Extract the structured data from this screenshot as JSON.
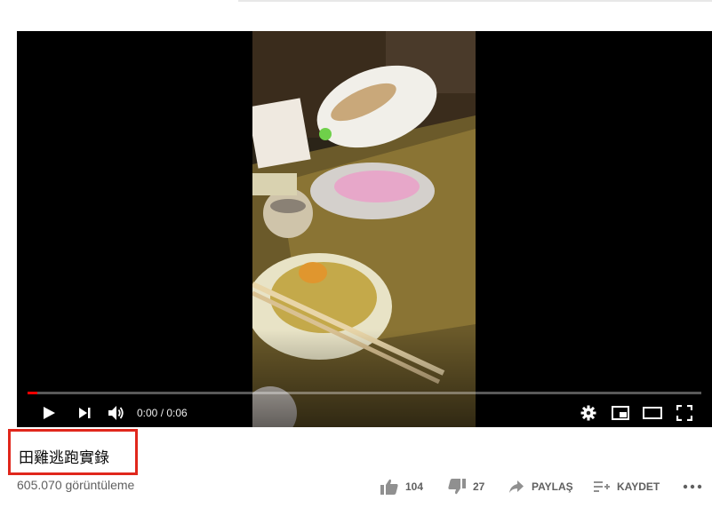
{
  "video": {
    "time_display": "0:00 / 0:06",
    "progress_fraction": 0.015
  },
  "title": "田雞逃跑實錄",
  "views": "605.070 görüntüleme",
  "actions": {
    "like_count": "104",
    "dislike_count": "27",
    "share_label": "PAYLAŞ",
    "save_label": "KAYDET"
  },
  "icons": {
    "play": "play-icon",
    "next": "next-icon",
    "volume": "volume-icon",
    "settings": "gear-icon",
    "miniplayer": "miniplayer-icon",
    "theater": "theater-icon",
    "fullscreen": "fullscreen-icon",
    "like": "thumbs-up-icon",
    "dislike": "thumbs-down-icon",
    "share": "share-arrow-icon",
    "save": "playlist-add-icon",
    "more": "more-icon"
  },
  "colors": {
    "progress": "#ff0000",
    "highlight_box": "#e0271c",
    "secondary_text": "#606060"
  }
}
